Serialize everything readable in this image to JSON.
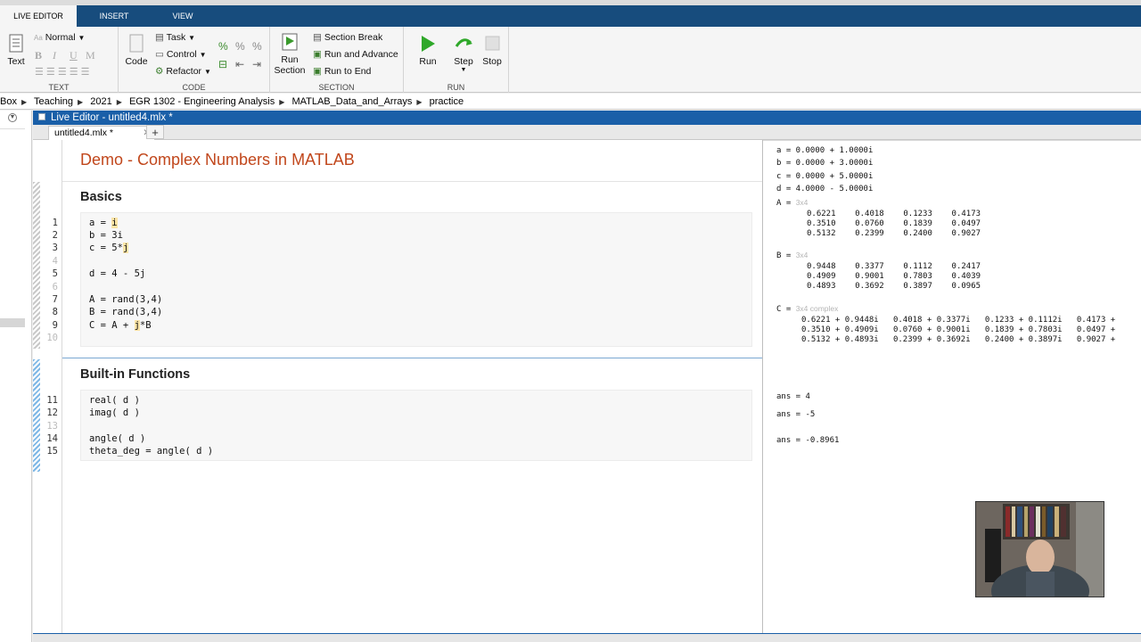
{
  "ribbon_tabs": [
    "LIVE EDITOR",
    "INSERT",
    "VIEW"
  ],
  "text_group": {
    "text_label": "Text",
    "style_value": "Normal",
    "bold": "B",
    "italic": "I",
    "underline": "U",
    "mono": "M",
    "label": "TEXT"
  },
  "code_group": {
    "code_label": "Code",
    "task": "Task",
    "control": "Control",
    "refactor": "Refactor",
    "label": "CODE"
  },
  "section_group": {
    "run_section": "Run\nSection",
    "run_section_l1": "Run",
    "run_section_l2": "Section",
    "section_break": "Section Break",
    "run_and_advance": "Run and Advance",
    "run_to_end": "Run to End",
    "label": "SECTION"
  },
  "run_group": {
    "run": "Run",
    "step": "Step",
    "stop": "Stop",
    "label": "RUN"
  },
  "breadcrumb": [
    "Box",
    "Teaching",
    "2021",
    "EGR 1302 - Engineering Analysis",
    "MATLAB_Data_and_Arrays",
    "practice"
  ],
  "editor": {
    "window_title": "Live Editor - untitled4.mlx *",
    "file_tab": "untitled4.mlx *",
    "close_glyph": "✕",
    "new_tab_glyph": "+",
    "title": "Demo - Complex Numbers in MATLAB",
    "sections": [
      {
        "heading": "Basics"
      },
      {
        "heading": "Built-in Functions"
      }
    ],
    "line_numbers": [
      "1",
      "2",
      "3",
      "4",
      "5",
      "6",
      "7",
      "8",
      "9",
      "10",
      "11",
      "12",
      "13",
      "14",
      "15"
    ],
    "code": {
      "l1a": "a = ",
      "l1b": "i",
      "l2": "b = 3i",
      "l3a": "c = 5*",
      "l3b": "j",
      "l5": "d = 4 - 5j",
      "l7": "A = rand(3,4)",
      "l8": "B = rand(3,4)",
      "l9a": "C = A + ",
      "l9b": "j",
      "l9c": "*B",
      "l11": "real( d )",
      "l12": "imag( d )",
      "l14": "angle( d )",
      "l15": "theta_deg = angle( d )"
    }
  },
  "output": {
    "a": "a = 0.0000 + 1.0000i",
    "b": "b = 0.0000 + 3.0000i",
    "c": "c = 0.0000 + 5.0000i",
    "d": "d = 4.0000 - 5.0000i",
    "A_label": "A = ",
    "A_dim": "3x4",
    "A_rows": "0.6221    0.4018    0.1233    0.4173\n0.3510    0.0760    0.1839    0.0497\n0.5132    0.2399    0.2400    0.9027",
    "B_label": "B = ",
    "B_dim": "3x4",
    "B_rows": "0.9448    0.3377    0.1112    0.2417\n0.4909    0.9001    0.7803    0.4039\n0.4893    0.3692    0.3897    0.0965",
    "C_label": "C = ",
    "C_dim": "3x4 complex",
    "C_rows": "0.6221 + 0.9448i   0.4018 + 0.3377i   0.1233 + 0.1112i   0.4173 +\n0.3510 + 0.4909i   0.0760 + 0.9001i   0.1839 + 0.7803i   0.0497 +\n0.5132 + 0.4893i   0.2399 + 0.3692i   0.2400 + 0.3897i   0.9027 +",
    "ans1": "ans = 4",
    "ans2": "ans = -5",
    "ans3": "ans = -0.8961"
  },
  "colors": {
    "ribbon_tab_bg": "#174c7d",
    "title_bar": "#1a5fa8",
    "heading": "#c1471c",
    "highlight": "#fbe4a6"
  }
}
